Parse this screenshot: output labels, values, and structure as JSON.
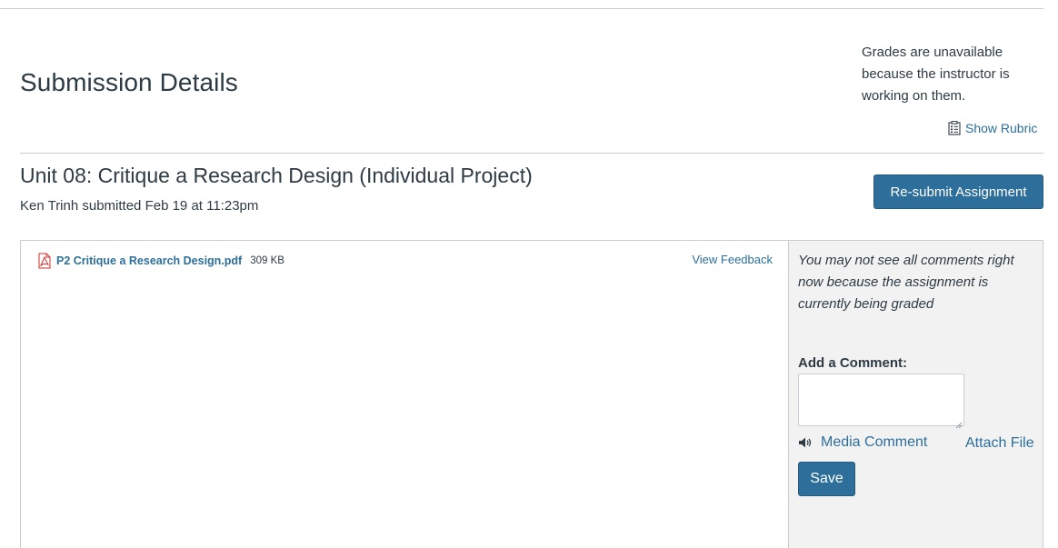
{
  "header": {
    "title": "Submission Details",
    "grade_note": "Grades are unavailable because the instructor is working on them.",
    "show_rubric_label": "Show Rubric"
  },
  "assignment": {
    "title": "Unit 08: Critique a Research Design (Individual Project)",
    "submitted_by": "Ken Trinh submitted Feb 19 at 11:23pm",
    "resubmit_label": "Re-submit Assignment"
  },
  "submission": {
    "file_name": "P2 Critique a Research Design.pdf",
    "file_size": "309 KB",
    "view_feedback_label": "View Feedback"
  },
  "comments": {
    "note": "You may not see all comments right now because the assignment is currently being graded",
    "add_comment_label": "Add a Comment:",
    "comment_value": "",
    "media_comment_label": "Media Comment",
    "attach_file_label": "Attach File",
    "save_label": "Save"
  },
  "icons": {
    "rubric": "rubric-icon",
    "pdf": "pdf-file-icon",
    "speaker": "speaker-icon"
  },
  "colors": {
    "link": "#2d6f9a",
    "button_bg": "#2d6f9a",
    "text": "#2d3b45",
    "panel_bg": "#f2f2f2",
    "border": "#c7cdd1"
  }
}
